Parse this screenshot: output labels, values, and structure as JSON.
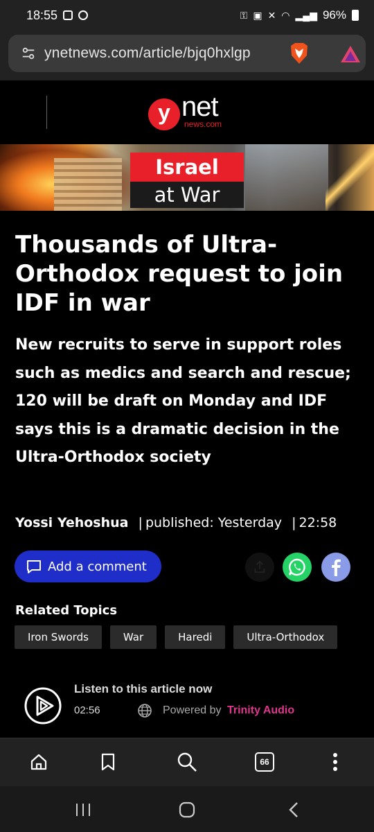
{
  "status_bar": {
    "time": "18:55",
    "battery": "96%"
  },
  "address_bar": {
    "url": "ynetnews.com/article/bjq0hxlgp"
  },
  "site": {
    "logo_main": "net",
    "logo_letter": "y",
    "logo_sub": "news.com"
  },
  "banner": {
    "line1": "Israel",
    "line2": "at War"
  },
  "article": {
    "headline": "Thousands of Ultra-Orthodox request to join IDF in war",
    "subheadline": "New recruits to serve in support roles such as medics and search and rescue; 120 will be draft on Monday and IDF says this is a dramatic decision in the Ultra-Orthodox society",
    "author": "Yossi Yehoshua",
    "published_label": "published: Yesterday",
    "published_time": "22:58",
    "separator": "|"
  },
  "actions": {
    "comment_label": "Add a comment"
  },
  "related": {
    "title": "Related Topics",
    "tags": [
      "Iron Swords",
      "War",
      "Haredi",
      "Ultra-Orthodox"
    ]
  },
  "audio": {
    "title": "Listen to this article now",
    "duration": "02:56",
    "powered_by": "Powered by",
    "provider": "Trinity Audio"
  },
  "toolbar": {
    "tab_count": "66"
  },
  "colors": {
    "accent_red": "#e8202a",
    "comment_blue": "#1f2ec8",
    "whatsapp_green": "#25d366",
    "facebook_blue": "#8a9be8",
    "trinity_pink": "#e0368e"
  }
}
